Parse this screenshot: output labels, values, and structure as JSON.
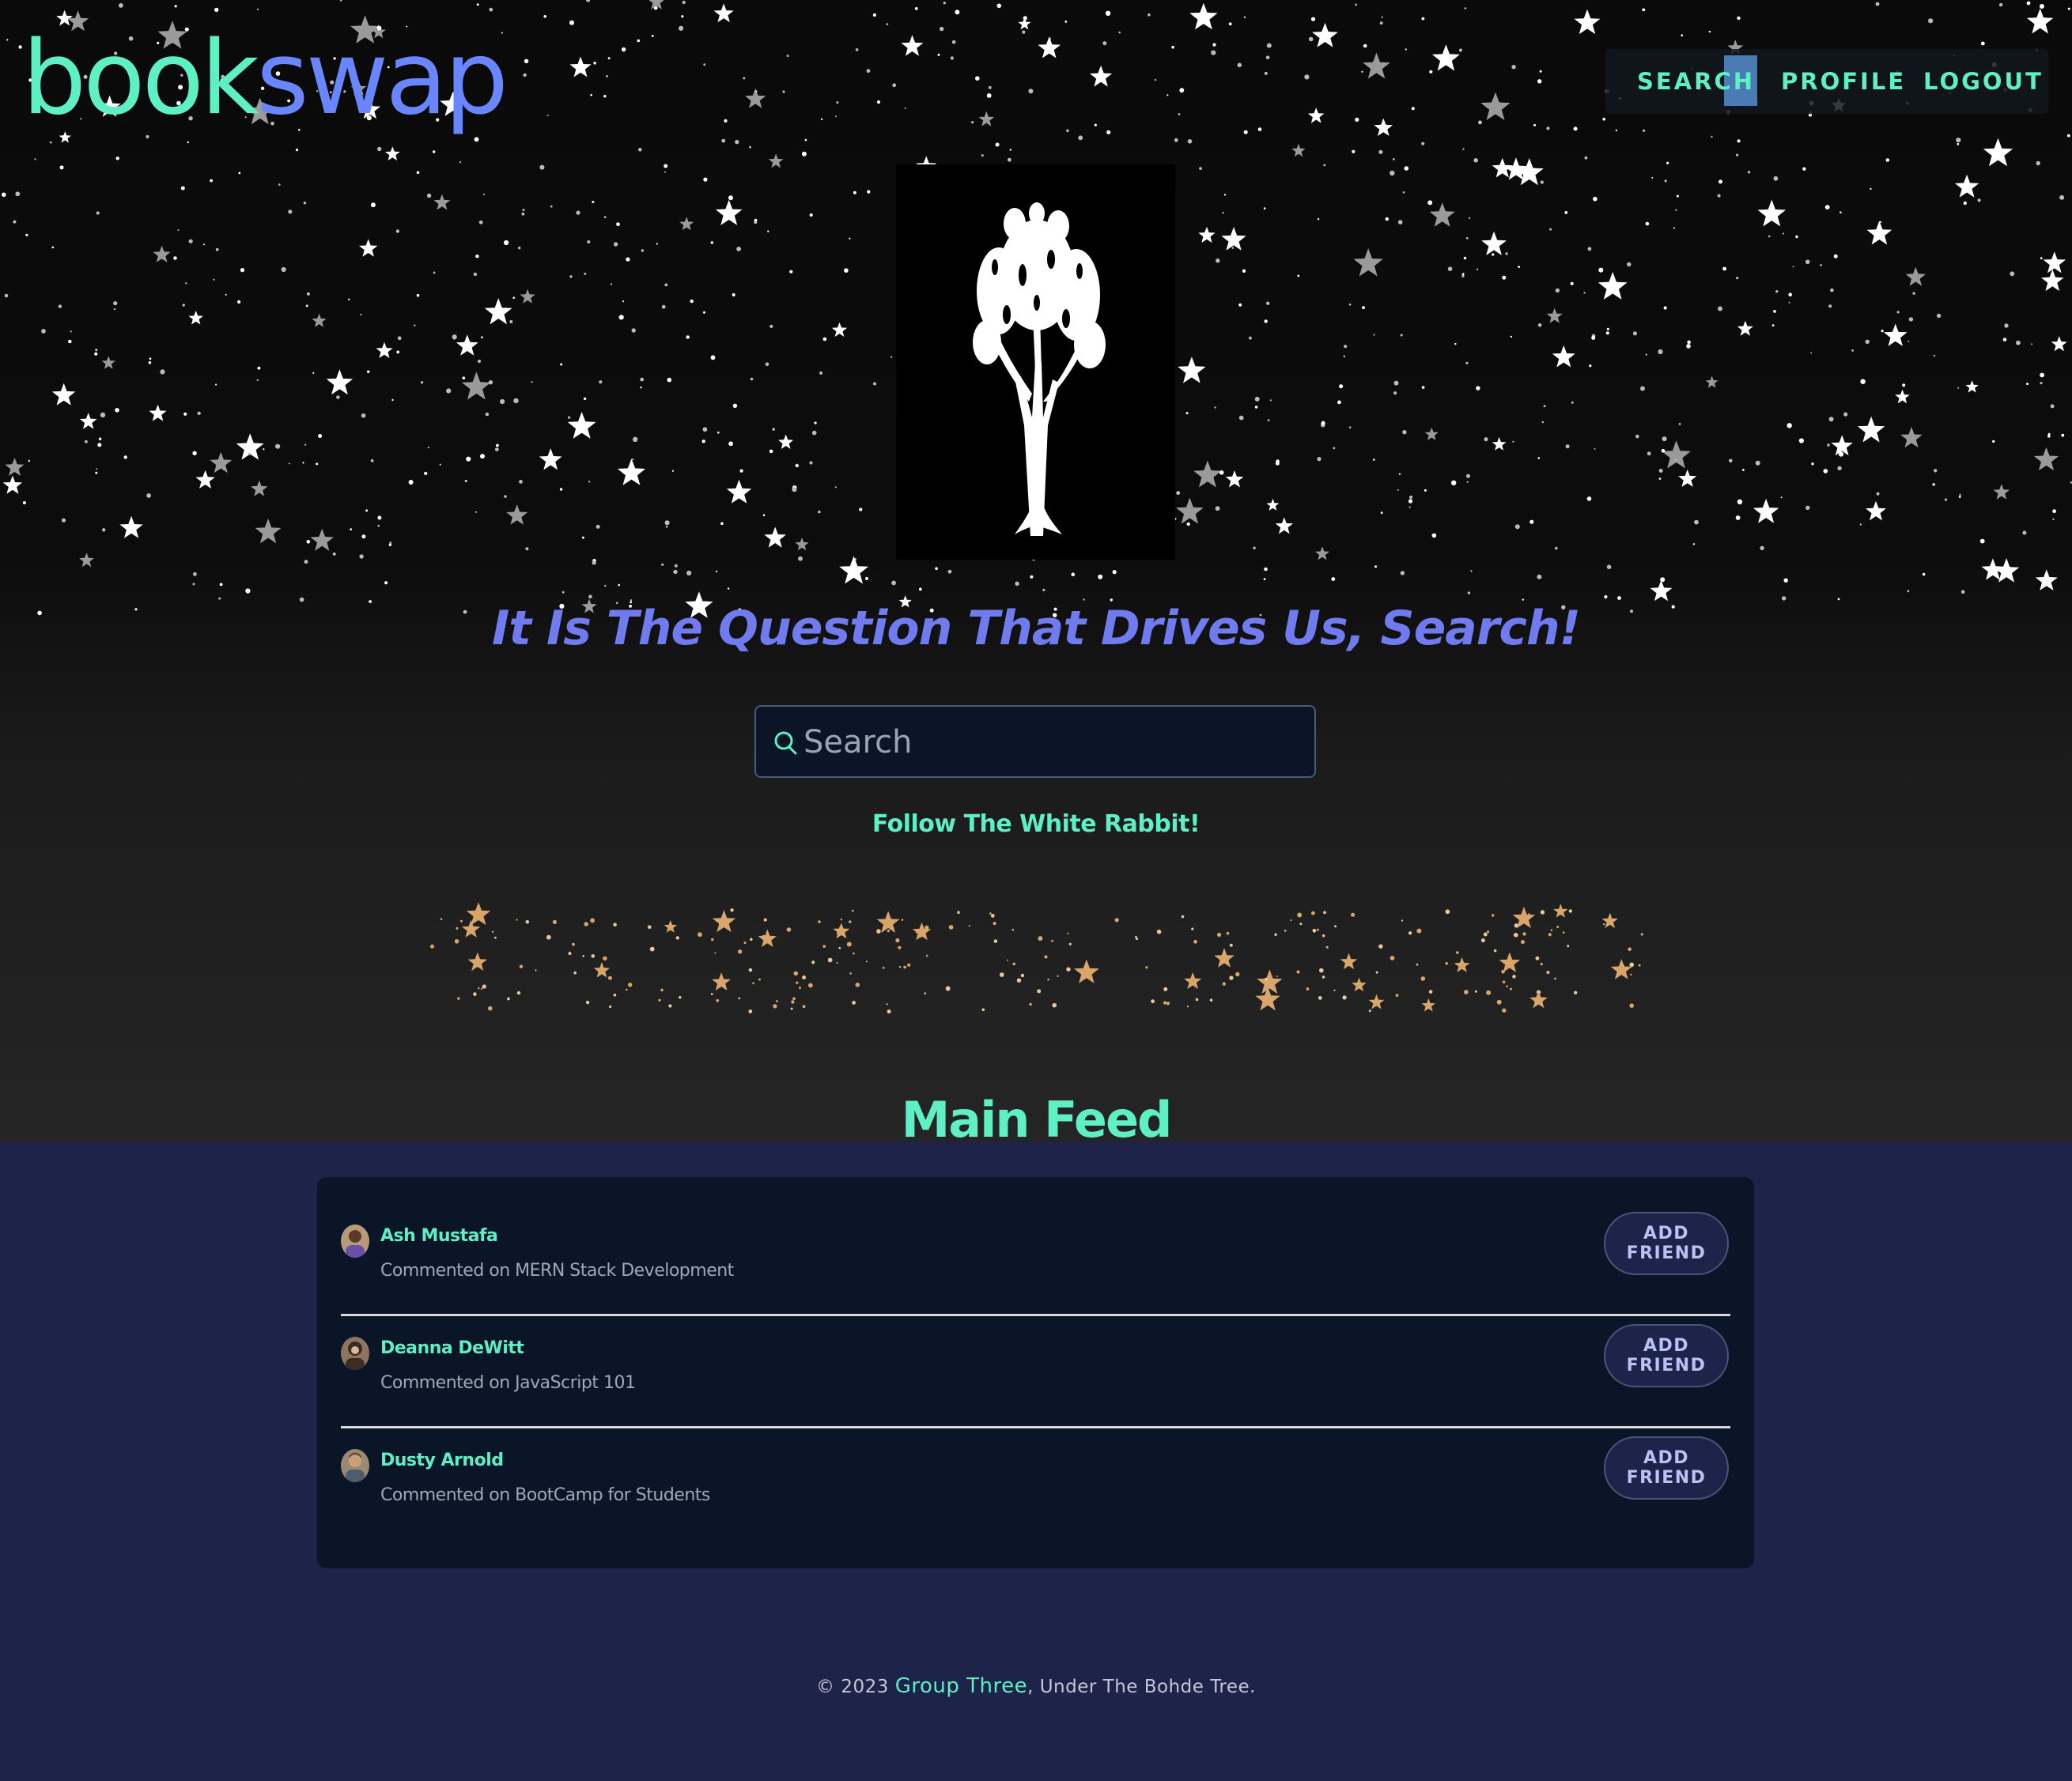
{
  "header": {
    "logo_part1": "book",
    "logo_part2": "swap",
    "nav": {
      "search": "SEARCH",
      "profile": "PROFILE",
      "logout": "LOGOUT"
    }
  },
  "hero": {
    "tagline": "It Is The Question That Drives Us, Search!",
    "search_placeholder": "Search",
    "rabbit_link": "Follow The White Rabbit!"
  },
  "feed": {
    "title": "Main Feed",
    "items": [
      {
        "name": "Ash Mustafa",
        "comment": "Commented on MERN Stack Development",
        "button": "ADD FRIEND"
      },
      {
        "name": "Deanna DeWitt",
        "comment": "Commented on JavaScript 101",
        "button": "ADD FRIEND"
      },
      {
        "name": "Dusty Arnold",
        "comment": "Commented on BootCamp for Students",
        "button": "ADD FRIEND"
      }
    ]
  },
  "footer": {
    "prefix": "© 2023 ",
    "group": "Group Three",
    "suffix": ", Under The Bohde Tree."
  },
  "colors": {
    "accent_green": "#5eefc2",
    "accent_blue": "#6a86ff",
    "tagline": "#6f7bef",
    "page_bg": "#1e2349",
    "card_bg": "#0b1528"
  },
  "icons": [
    "search-icon",
    "tree-logo-image",
    "avatar"
  ]
}
